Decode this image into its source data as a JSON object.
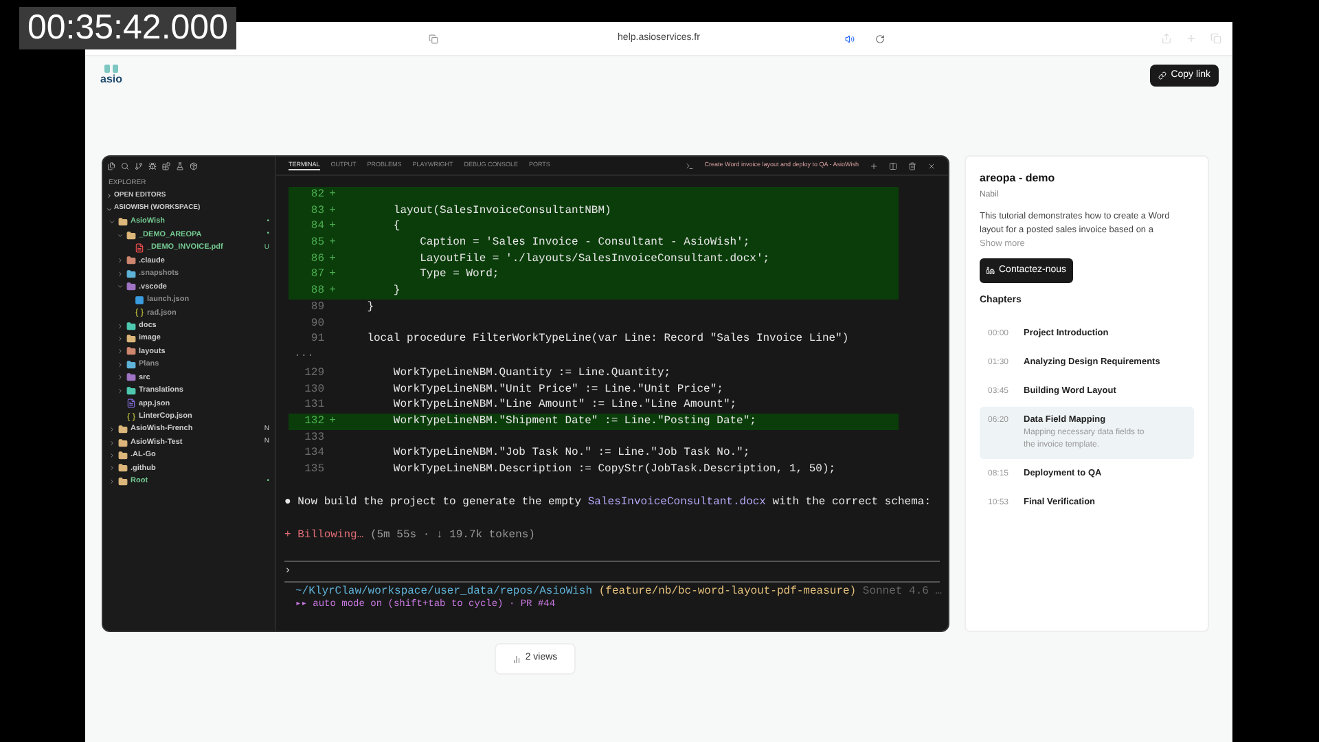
{
  "recording_timestamp": "00:35:42.000",
  "browser": {
    "url": "help.asioservices.fr"
  },
  "header": {
    "logo_text": "asio",
    "copy_link": "Copy link"
  },
  "video": {
    "explorer": {
      "title": "EXPLORER",
      "sections": [
        {
          "label": "OPEN EDITORS",
          "expanded": false
        },
        {
          "label": "ASIOWISH (WORKSPACE)",
          "expanded": true
        }
      ],
      "tree": [
        {
          "label": "AsioWish",
          "kind": "root",
          "expanded": true,
          "color": "#73c991",
          "badge": "•",
          "children": [
            {
              "label": "_DEMO_AREOPA",
              "kind": "folder",
              "expanded": true,
              "color": "#73c991",
              "badge": "•",
              "children": [
                {
                  "label": "_DEMO_INVOICE.pdf",
                  "kind": "pdf",
                  "color": "#73c991",
                  "badge": "U"
                }
              ]
            },
            {
              "label": ".claude",
              "kind": "folder",
              "expanded": false,
              "color": "#cccccc"
            },
            {
              "label": ".snapshots",
              "kind": "folder",
              "expanded": false,
              "color": "#8c8c8c"
            },
            {
              "label": ".vscode",
              "kind": "folder",
              "expanded": true,
              "color": "#cccccc",
              "children": [
                {
                  "label": "launch.json",
                  "kind": "vscode",
                  "color": "#8c8c8c"
                },
                {
                  "label": "rad.json",
                  "kind": "json",
                  "color": "#8c8c8c"
                }
              ]
            },
            {
              "label": "docs",
              "kind": "folder",
              "expanded": false,
              "color": "#cccccc"
            },
            {
              "label": "image",
              "kind": "folder",
              "expanded": false,
              "color": "#cccccc"
            },
            {
              "label": "layouts",
              "kind": "folder",
              "expanded": false,
              "color": "#cccccc"
            },
            {
              "label": "Plans",
              "kind": "folder",
              "expanded": false,
              "color": "#8c8c8c"
            },
            {
              "label": "src",
              "kind": "folder",
              "expanded": false,
              "color": "#cccccc"
            },
            {
              "label": "Translations",
              "kind": "folder",
              "expanded": false,
              "color": "#cccccc"
            },
            {
              "label": "app.json",
              "kind": "al",
              "color": "#cccccc"
            },
            {
              "label": "LinterCop.json",
              "kind": "json",
              "color": "#cccccc"
            }
          ]
        },
        {
          "label": "AsioWish-French",
          "kind": "root",
          "expanded": false,
          "color": "#cccccc",
          "badge": "N"
        },
        {
          "label": "AsioWish-Test",
          "kind": "root",
          "expanded": false,
          "color": "#cccccc",
          "badge": "N"
        },
        {
          "label": ".AL-Go",
          "kind": "root",
          "expanded": false,
          "color": "#cccccc"
        },
        {
          "label": ".github",
          "kind": "root",
          "expanded": false,
          "color": "#cccccc"
        },
        {
          "label": "Root",
          "kind": "root",
          "expanded": false,
          "color": "#73c991",
          "badge": "•"
        }
      ]
    },
    "panel_tabs": [
      {
        "label": "TERMINAL",
        "selected": true
      },
      {
        "label": "OUTPUT",
        "selected": false
      },
      {
        "label": "PROBLEMS",
        "selected": false
      },
      {
        "label": "PLAYWRIGHT",
        "selected": false
      },
      {
        "label": "DEBUG CONSOLE",
        "selected": false
      },
      {
        "label": "PORTS",
        "selected": false
      }
    ],
    "terminal_title": "Create Word invoice layout and deploy to QA - AsioWish",
    "diff_blocks": [
      {
        "lines": [
          {
            "num": "82",
            "marker": "+",
            "added": true
          },
          {
            "num": "83",
            "marker": "+",
            "code": "    layout(SalesInvoiceConsultantNBM)",
            "added": true
          },
          {
            "num": "84",
            "marker": "+",
            "code": "    {",
            "added": true
          },
          {
            "num": "85",
            "marker": "+",
            "code": "        Caption = 'Sales Invoice - Consultant - AsioWish';",
            "added": true
          },
          {
            "num": "86",
            "marker": "+",
            "code": "        LayoutFile = './layouts/SalesInvoiceConsultant.docx';",
            "added": true
          },
          {
            "num": "87",
            "marker": "+",
            "code": "        Type = Word;",
            "added": true
          },
          {
            "num": "88",
            "marker": "+",
            "code": "    }",
            "added": true
          },
          {
            "num": "89",
            "code": "}",
            "added": false
          },
          {
            "num": "90",
            "added": false
          },
          {
            "num": "91",
            "code": "local procedure FilterWorkTypeLine(var Line: Record \"Sales Invoice Line\")",
            "added": false
          }
        ]
      },
      {
        "gap": "...",
        "lines": [
          {
            "num": "129",
            "code": "    WorkTypeLineNBM.Quantity := Line.Quantity;",
            "added": false
          },
          {
            "num": "130",
            "code": "    WorkTypeLineNBM.\"Unit Price\" := Line.\"Unit Price\";",
            "added": false
          },
          {
            "num": "131",
            "code": "    WorkTypeLineNBM.\"Line Amount\" := Line.\"Line Amount\";",
            "added": false
          },
          {
            "num": "132",
            "marker": "+",
            "code": "    WorkTypeLineNBM.\"Shipment Date\" := Line.\"Posting Date\";",
            "added": true
          },
          {
            "num": "133",
            "added": false
          },
          {
            "num": "134",
            "code": "    WorkTypeLineNBM.\"Job Task No.\" := Line.\"Job Task No.\";",
            "added": false
          },
          {
            "num": "135",
            "code": "    WorkTypeLineNBM.Description := CopyStr(JobTask.Description, 1, 50);",
            "added": false
          }
        ]
      }
    ],
    "message": {
      "bullet": "●",
      "before": "Now build the project to generate the empty ",
      "file": "SalesInvoiceConsultant.docx",
      "after": " with the correct schema:"
    },
    "spinner": {
      "glyph": "+",
      "verb": "Billowing…",
      "detail": "(5m 55s · ↓ 19.7k tokens)"
    },
    "prompt": "›",
    "status": {
      "path": "~/KlyrClaw/workspace/user_data/repos/AsioWish",
      "branch": "(feature/nb/bc-word-layout-pdf-measure)",
      "model": "Sonnet 4.6 …",
      "mode": "▸▸ auto mode on (shift+tab to cycle) · PR #44"
    }
  },
  "details": {
    "title": "areopa - demo",
    "author": "Nabil",
    "description": "This tutorial demonstrates how to create a Word layout for a posted sales invoice based on a",
    "show_more": "Show more",
    "contact_button": "Contactez-nous",
    "chapters_heading": "Chapters",
    "chapters": [
      {
        "time": "00:00",
        "title": "Project Introduction",
        "selected": false
      },
      {
        "time": "01:30",
        "title": "Analyzing Design Requirements",
        "selected": false
      },
      {
        "time": "03:45",
        "title": "Building Word Layout",
        "selected": false
      },
      {
        "time": "06:20",
        "title": "Data Field Mapping",
        "selected": true,
        "description": "Mapping necessary data fields to the invoice template."
      },
      {
        "time": "08:15",
        "title": "Deployment to QA",
        "selected": false
      },
      {
        "time": "10:53",
        "title": "Final Verification",
        "selected": false
      }
    ]
  },
  "views": "2 views"
}
